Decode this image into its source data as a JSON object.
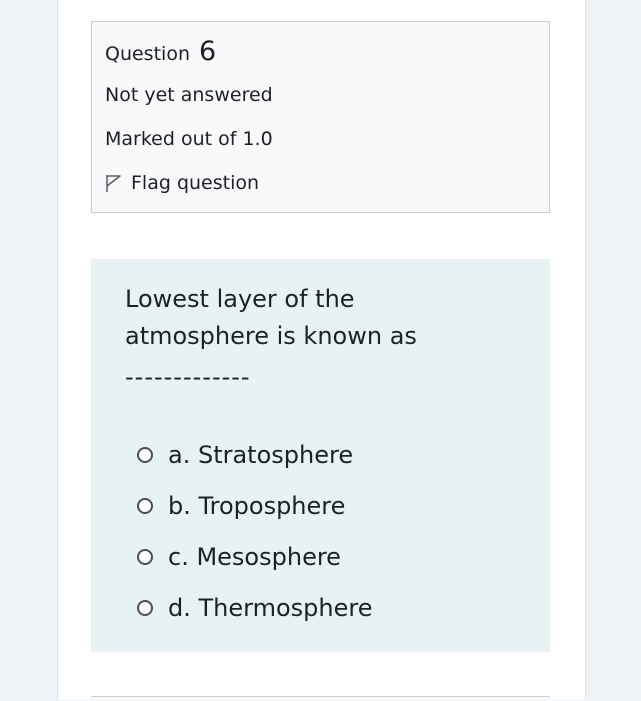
{
  "question_info": {
    "label": "Question",
    "number": "6",
    "state": "Not yet answered",
    "grade": "Marked out of 1.0",
    "flag_label": "Flag question",
    "flag_icon": "flag-outline-icon"
  },
  "question": {
    "text": "Lowest layer of the atmosphere is known as",
    "blank": "-------------",
    "answers": [
      {
        "label": "a. Stratosphere",
        "selected": false
      },
      {
        "label": "b. Troposphere",
        "selected": false
      },
      {
        "label": "c. Mesosphere",
        "selected": false
      },
      {
        "label": "d. Thermosphere",
        "selected": false
      }
    ]
  },
  "colors": {
    "background": "#eef3f7",
    "info_box": "#f8f9fa",
    "question_box": "#e7f2f5",
    "text": "#1d2125"
  }
}
